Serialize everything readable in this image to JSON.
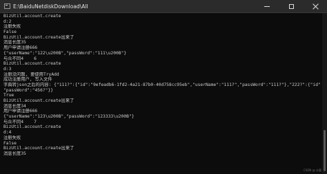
{
  "window": {
    "title": "E:\\BaiduNetdiskDownload\\All",
    "controls": {
      "minimize_icon": "minimize-icon",
      "maximize_icon": "maximize-icon",
      "close_icon": "close-icon"
    }
  },
  "console": {
    "lines": [
      "BizUtil.account.create",
      "d:2",
      "注册失败",
      "False",
      "BizUtil.account.create出来了",
      "消息长度35",
      "用户申请注册666",
      "{\"userName\":\"122\\u200B\",\"passWord\":\"111\\u200B\"}",
      "与众不同4    6",
      "BizUtil.account.create",
      "d:3",
      "注册没问题, 要使用TryAdd",
      "成功注册用户, 写入文件",
      "字典转json之后的内容: {\"111?\":{\"id\":\"9efeadb6-1fd2-4a21-87b0-40d758cc95eb\",\"userName\":\"111?\",\"passWord\":\"111?\"},\"222?\":{\"id\":\"d569d374-6ab1-4715-97ed-9ea6ef3794fa\",\"userName\":\"222?\",\"passWord\":\"222?\"},\"122?\":{\"id\":\"8a9de532-f9f1-4c64-a28e-d01590bae35\",\"userName\":\"122?\",\"passWord\":\"111?\"},\"123?\":{\"id\":\"81cdf583-d963-4477-98e3-ca34b0c9535f\",\"userName\":\"123?\",",
      "\"passWord\":\"456?\"}}",
      "True",
      "BizUtil.account.create出来了",
      "消息长度34",
      "用户申请注册666",
      "{\"userName\":\"123\\u200B\",\"passWord\":\"123333\\u200B\"}",
      "与众不同4    7",
      "BizUtil.account.create",
      "d:4",
      "注册失败",
      "False",
      "BizUtil.account.create出来了",
      "消息长度35"
    ]
  },
  "watermark": "CSDN @ 水墨"
}
